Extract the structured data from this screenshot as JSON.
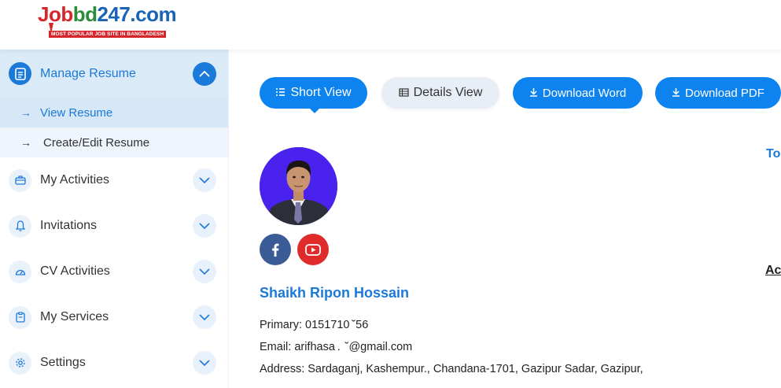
{
  "logo": {
    "part1": "Job",
    "part2": "bd",
    "part3": "247.com",
    "tagline": "MOST POPULAR JOB SITE IN BANGLADESH"
  },
  "sidebar": {
    "manage_resume": {
      "label": "Manage Resume",
      "sub_items": [
        {
          "label": "View Resume"
        },
        {
          "label": "Create/Edit Resume"
        }
      ]
    },
    "items": [
      {
        "label": "My Activities",
        "icon": "briefcase-icon"
      },
      {
        "label": "Invitations",
        "icon": "bell-icon"
      },
      {
        "label": "CV Activities",
        "icon": "gauge-icon"
      },
      {
        "label": "My Services",
        "icon": "clipboard-icon"
      },
      {
        "label": "Settings",
        "icon": "gear-icon"
      }
    ]
  },
  "toolbar": {
    "short_view": "Short View",
    "details_view": "Details View",
    "download_word": "Download Word",
    "download_pdf": "Download PDF"
  },
  "profile": {
    "name": "Shaikh Ripon Hossain",
    "primary": "Primary: 0151710 ˘56",
    "email": "Email: arifhasa .  ˘@gmail.com",
    "address": "Address: Sardaganj, Kashempur., Chandana-1701, Gazipur Sadar, Gazipur,"
  },
  "right_edge": {
    "top_label": "To",
    "mid_label": "Ac"
  },
  "colors": {
    "accent": "#0d83f0",
    "active_bg": "#dbeaf7",
    "facebook": "#3b5b97",
    "youtube": "#e02b2b"
  }
}
